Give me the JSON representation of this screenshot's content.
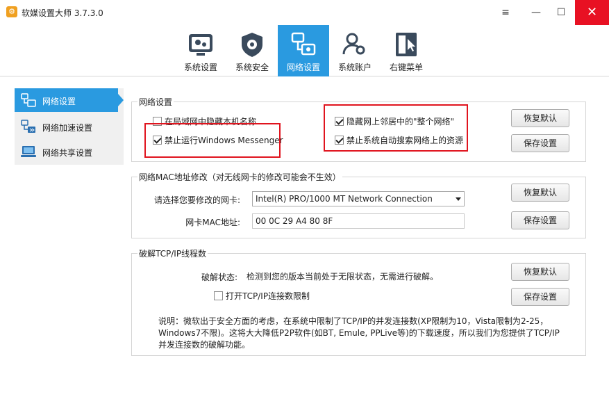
{
  "app": {
    "title": "软媒设置大师 3.7.3.0"
  },
  "window_controls": {
    "menu": "≡",
    "minimize": "—",
    "maximize": "☐",
    "close": "✕"
  },
  "toolbar": {
    "tabs": [
      {
        "label": "系统设置",
        "icon": "system-settings-icon"
      },
      {
        "label": "系统安全",
        "icon": "shield-icon"
      },
      {
        "label": "网络设置",
        "icon": "network-icon",
        "active": true
      },
      {
        "label": "系统账户",
        "icon": "users-icon"
      },
      {
        "label": "右键菜单",
        "icon": "context-menu-icon"
      }
    ]
  },
  "sidebar": {
    "items": [
      {
        "label": "网络设置",
        "icon": "network-settings-icon",
        "active": true
      },
      {
        "label": "网络加速设置",
        "icon": "network-speed-icon"
      },
      {
        "label": "网络共享设置",
        "icon": "network-share-icon"
      }
    ]
  },
  "network": {
    "title": "网络设置",
    "options": {
      "hide_in_lan": {
        "label": "在局域网中隐藏本机名称",
        "checked": false
      },
      "disable_messenger": {
        "label": "禁止运行Windows Messenger",
        "checked": true
      },
      "hide_entire_network": {
        "label": "隐藏网上邻居中的\"整个网络\"",
        "checked": true
      },
      "disable_auto_search": {
        "label": "禁止系统自动搜索网络上的资源",
        "checked": true
      }
    },
    "restore_label": "恢复默认",
    "save_label": "保存设置"
  },
  "mac": {
    "title": "网络MAC地址修改（对无线网卡的修改可能会不生效）",
    "adapter_label": "请选择您要修改的网卡:",
    "adapter_value": "Intel(R) PRO/1000 MT Network Connection",
    "mac_label": "网卡MAC地址:",
    "mac_value": "00 0C 29 A4 80 8F",
    "restore_label": "恢复默认",
    "save_label": "保存设置"
  },
  "tcp": {
    "title": "破解TCP/IP线程数",
    "status_label": "破解状态:",
    "status_text": "检测到您的版本当前处于无限状态，无需进行破解。",
    "open_limit_label": "打开TCP/IP连接数限制",
    "open_limit_checked": false,
    "note_line1": "说明：微软出于安全方面的考虑，在系统中限制了TCP/IP的并发连接数(XP限制为10，Vista限制为2-25，",
    "note_line2": "Windows7不限)。这将大大降低P2P软件(如BT, Emule, PPLive等)的下载速度，所以我们为您提供了TCP/IP",
    "note_line3": "并发连接数的破解功能。",
    "restore_label": "恢复默认",
    "save_label": "保存设置"
  },
  "colors": {
    "accent": "#2a9ae0",
    "close": "#e81123",
    "highlight": "#e0141e"
  }
}
